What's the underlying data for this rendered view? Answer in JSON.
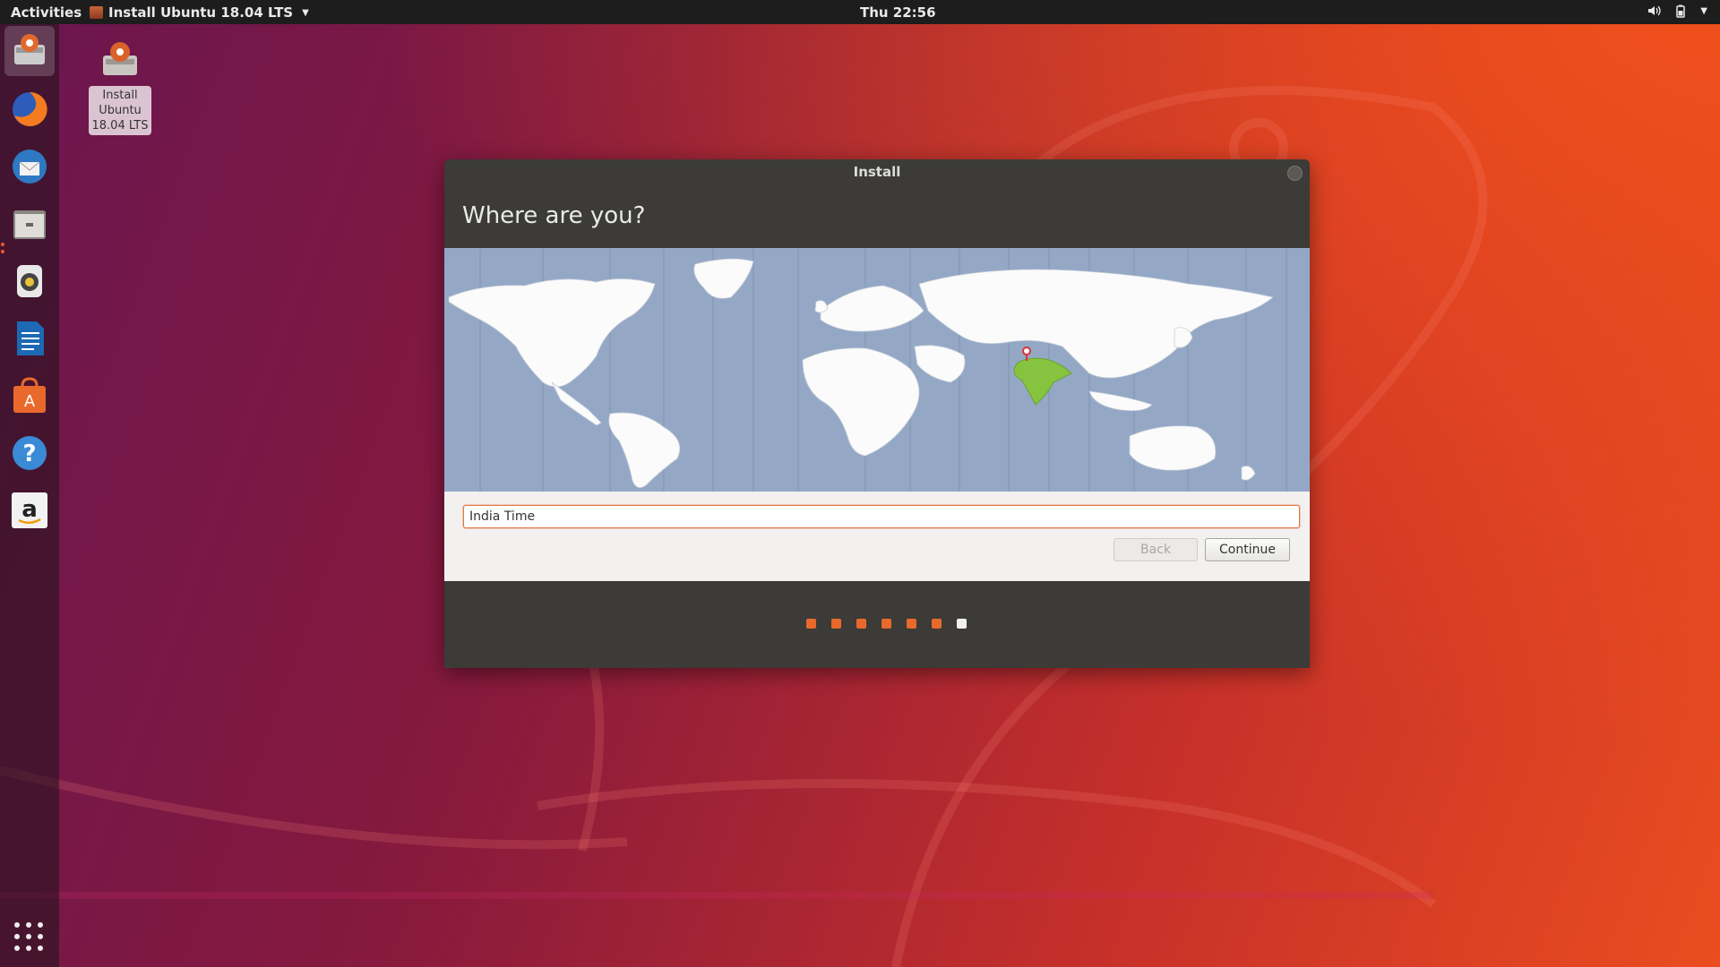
{
  "topbar": {
    "activities": "Activities",
    "app_title": "Install Ubuntu 18.04 LTS",
    "clock": "Thu 22:56",
    "tray_icons": [
      "volume-icon",
      "battery-icon",
      "system-menu-icon"
    ]
  },
  "dock": {
    "items": [
      {
        "name": "ubuntu-installer-icon",
        "active": true
      },
      {
        "name": "firefox-icon"
      },
      {
        "name": "thunderbird-icon"
      },
      {
        "name": "files-icon",
        "running": true
      },
      {
        "name": "rhythmbox-icon"
      },
      {
        "name": "libreoffice-writer-icon"
      },
      {
        "name": "ubuntu-software-icon"
      },
      {
        "name": "help-icon"
      },
      {
        "name": "amazon-icon"
      }
    ],
    "show_apps": "apps-grid-icon"
  },
  "desktop": {
    "install_icon_label": "Install Ubuntu 18.04 LTS"
  },
  "window": {
    "title": "Install",
    "heading": "Where are you?",
    "timezone_value": "India Time",
    "selected_region": "India",
    "back_label": "Back",
    "continue_label": "Continue",
    "progress": {
      "total_steps": 7,
      "current_step": 7
    }
  },
  "colors": {
    "accent": "#e9692c",
    "window_bg": "#3c3b37",
    "map_ocean": "#94a8c6",
    "selected_land": "#86c440"
  }
}
